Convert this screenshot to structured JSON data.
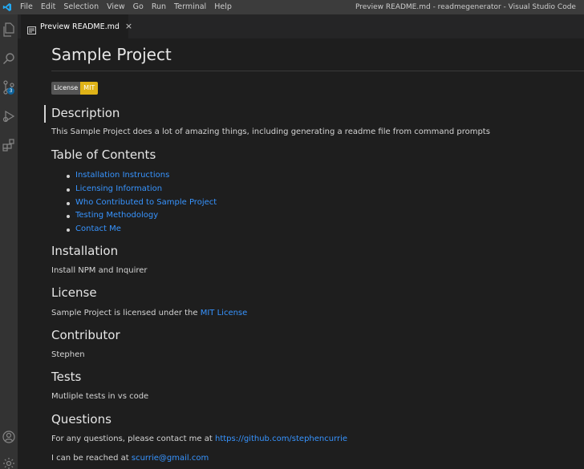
{
  "menu": [
    "File",
    "Edit",
    "Selection",
    "View",
    "Go",
    "Run",
    "Terminal",
    "Help"
  ],
  "window_title": "Preview README.md - readmegenerator - Visual Studio Code",
  "activity": {
    "source_control_badge": "3"
  },
  "tab": {
    "label": "Preview README.md",
    "close": "×"
  },
  "doc": {
    "title": "Sample Project",
    "badge": {
      "left": "License",
      "right": "MIT",
      "color": "#dfb317"
    },
    "description_heading": "Description",
    "description_text": "This Sample Project does a lot of amazing things, including generating a readme file from command prompts",
    "toc_heading": "Table of Contents",
    "toc": [
      "Installation Instructions",
      "Licensing Information",
      "Who Contributed to Sample Project",
      "Testing Methodology",
      "Contact Me"
    ],
    "installation_heading": "Installation",
    "installation_text": "Install NPM and Inquirer",
    "license_heading": "License",
    "license_text": "Sample Project is licensed under the ",
    "license_link": "MIT License",
    "contributor_heading": "Contributor",
    "contributor_text": "Stephen",
    "tests_heading": "Tests",
    "tests_text": "Mutliple tests in vs code",
    "questions_heading": "Questions",
    "questions_text": "For any questions, please contact me at ",
    "questions_link": "https://github.com/stephencurrie",
    "reach_text": "I can be reached at ",
    "reach_link": "scurrie@gmail.com"
  },
  "colors": {
    "link": "#3794ff",
    "background": "#1e1e1e",
    "accent": "#0e639c"
  }
}
